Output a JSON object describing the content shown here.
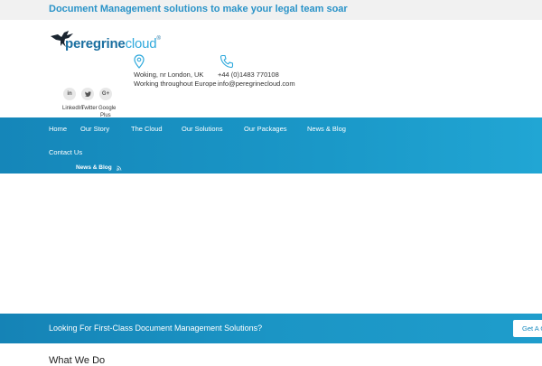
{
  "topbar": {
    "tagline": "Document Management solutions to make your legal team soar"
  },
  "logo": {
    "part1": "peregrine",
    "part2": "cloud",
    "reg": "®",
    "icon": "eagle-logo-icon"
  },
  "contact": {
    "address_line1": "Woking, nr London, UK",
    "address_line2": "Working throughout Europe",
    "phone": "+44 (0)1483 770108",
    "email": "info@peregrinecloud.com",
    "location_icon": "map-pin-icon",
    "phone_icon": "phone-icon"
  },
  "social": {
    "linkedin_glyph": "in",
    "twitter_glyph": "✓",
    "google_glyph": "G+",
    "linkedin_label": "LinkedIn",
    "twitter_label": "Twitter",
    "google_label": "Google",
    "google_label2": "Plus"
  },
  "nav": {
    "items": [
      "Home",
      "Our Story",
      "The Cloud",
      "Our Solutions",
      "Our Packages",
      "News & Blog",
      "Contact Us"
    ],
    "sub_label": "News & Blog",
    "sub_icon": "rss-icon"
  },
  "banner": {
    "text": "Looking For First-Class Document Management Solutions?",
    "button_label": "Get A Quote"
  },
  "section": {
    "heading": "What We Do"
  },
  "colors": {
    "brand_blue": "#2a93c8",
    "nav_gradient_start": "#1586b9",
    "nav_gradient_end": "#21a6d4"
  }
}
